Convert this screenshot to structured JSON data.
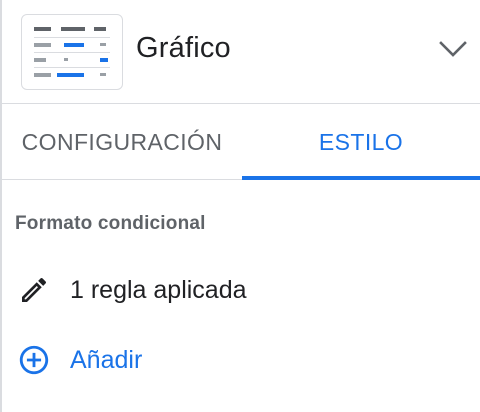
{
  "header": {
    "title": "Gráfico",
    "chart_thumbnail_icon": "table-chart-icon",
    "expand_icon": "chevron-down-icon"
  },
  "tabs": [
    {
      "label": "CONFIGURACIÓN",
      "active": false
    },
    {
      "label": "ESTILO",
      "active": true
    }
  ],
  "conditional_format": {
    "section_title": "Formato condicional",
    "rule_summary": "1 regla aplicada",
    "rule_icon": "pencil-icon",
    "add_label": "Añadir",
    "add_icon": "add-circle-icon"
  },
  "colors": {
    "accent": "#1a73e8",
    "text_primary": "#202124",
    "text_secondary": "#5f6368",
    "divider": "#dadce0"
  }
}
